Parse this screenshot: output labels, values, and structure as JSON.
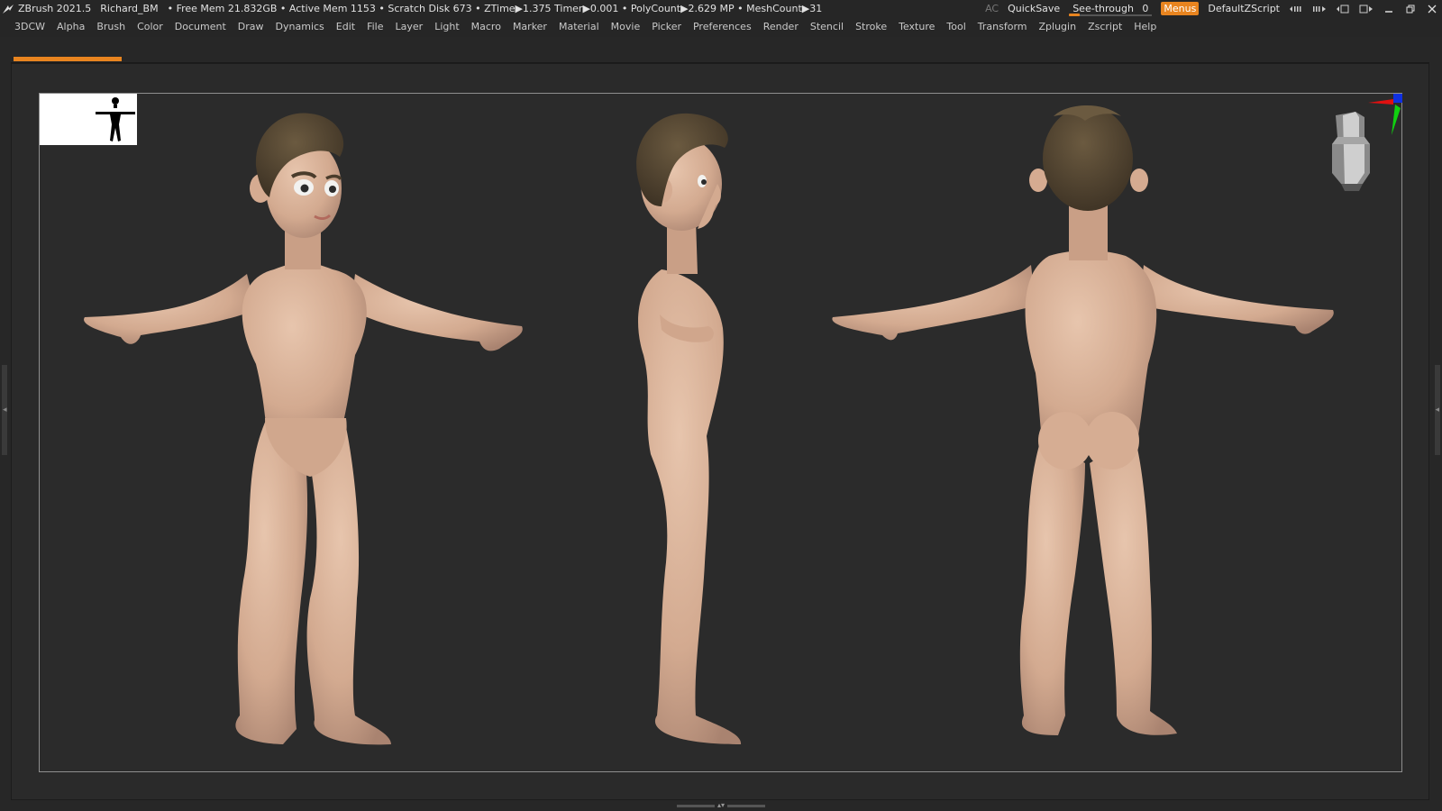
{
  "app": {
    "name": "ZBrush 2021.5",
    "project": "Richard_BM",
    "stats": "• Free Mem 21.832GB • Active Mem 1153 • Scratch Disk 673 • ZTime▶1.375 Timer▶0.001 • PolyCount▶2.629 MP • MeshCount▶31"
  },
  "topright": {
    "ac_label": "AC",
    "quicksave_label": "QuickSave",
    "seethrough_label": "See-through",
    "seethrough_value": "0",
    "menus_label": "Menus",
    "script_label": "DefaultZScript"
  },
  "menus": [
    "3DCW",
    "Alpha",
    "Brush",
    "Color",
    "Document",
    "Draw",
    "Dynamics",
    "Edit",
    "File",
    "Layer",
    "Light",
    "Macro",
    "Marker",
    "Material",
    "Movie",
    "Picker",
    "Preferences",
    "Render",
    "Stencil",
    "Stroke",
    "Texture",
    "Tool",
    "Transform",
    "Zplugin",
    "Zscript",
    "Help"
  ],
  "colors": {
    "accent": "#e8841f",
    "skin": "#d6ae95",
    "hair": "#5a4b36",
    "axis_x": "#e01010",
    "axis_y": "#10d010",
    "axis_z": "#1030e0"
  },
  "icons": {
    "app": "zbrush-logo-icon",
    "min": "minimize-icon",
    "restore": "restore-icon",
    "close": "close-icon"
  }
}
